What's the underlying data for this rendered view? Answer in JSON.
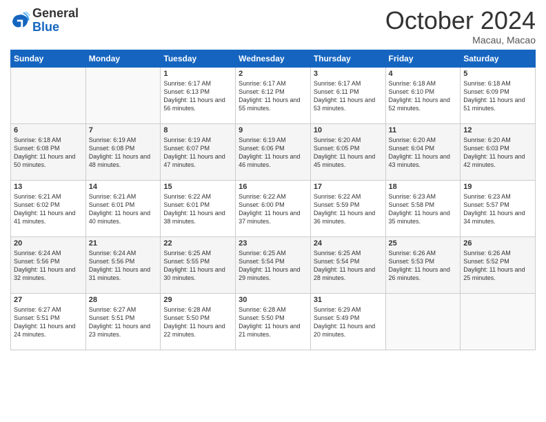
{
  "logo": {
    "line1": "General",
    "line2": "Blue"
  },
  "title": "October 2024",
  "location": "Macau, Macao",
  "days_of_week": [
    "Sunday",
    "Monday",
    "Tuesday",
    "Wednesday",
    "Thursday",
    "Friday",
    "Saturday"
  ],
  "weeks": [
    [
      {
        "day": "",
        "content": ""
      },
      {
        "day": "",
        "content": ""
      },
      {
        "day": "1",
        "content": "Sunrise: 6:17 AM\nSunset: 6:13 PM\nDaylight: 11 hours and 56 minutes."
      },
      {
        "day": "2",
        "content": "Sunrise: 6:17 AM\nSunset: 6:12 PM\nDaylight: 11 hours and 55 minutes."
      },
      {
        "day": "3",
        "content": "Sunrise: 6:17 AM\nSunset: 6:11 PM\nDaylight: 11 hours and 53 minutes."
      },
      {
        "day": "4",
        "content": "Sunrise: 6:18 AM\nSunset: 6:10 PM\nDaylight: 11 hours and 52 minutes."
      },
      {
        "day": "5",
        "content": "Sunrise: 6:18 AM\nSunset: 6:09 PM\nDaylight: 11 hours and 51 minutes."
      }
    ],
    [
      {
        "day": "6",
        "content": "Sunrise: 6:18 AM\nSunset: 6:08 PM\nDaylight: 11 hours and 50 minutes."
      },
      {
        "day": "7",
        "content": "Sunrise: 6:19 AM\nSunset: 6:08 PM\nDaylight: 11 hours and 48 minutes."
      },
      {
        "day": "8",
        "content": "Sunrise: 6:19 AM\nSunset: 6:07 PM\nDaylight: 11 hours and 47 minutes."
      },
      {
        "day": "9",
        "content": "Sunrise: 6:19 AM\nSunset: 6:06 PM\nDaylight: 11 hours and 46 minutes."
      },
      {
        "day": "10",
        "content": "Sunrise: 6:20 AM\nSunset: 6:05 PM\nDaylight: 11 hours and 45 minutes."
      },
      {
        "day": "11",
        "content": "Sunrise: 6:20 AM\nSunset: 6:04 PM\nDaylight: 11 hours and 43 minutes."
      },
      {
        "day": "12",
        "content": "Sunrise: 6:20 AM\nSunset: 6:03 PM\nDaylight: 11 hours and 42 minutes."
      }
    ],
    [
      {
        "day": "13",
        "content": "Sunrise: 6:21 AM\nSunset: 6:02 PM\nDaylight: 11 hours and 41 minutes."
      },
      {
        "day": "14",
        "content": "Sunrise: 6:21 AM\nSunset: 6:01 PM\nDaylight: 11 hours and 40 minutes."
      },
      {
        "day": "15",
        "content": "Sunrise: 6:22 AM\nSunset: 6:01 PM\nDaylight: 11 hours and 38 minutes."
      },
      {
        "day": "16",
        "content": "Sunrise: 6:22 AM\nSunset: 6:00 PM\nDaylight: 11 hours and 37 minutes."
      },
      {
        "day": "17",
        "content": "Sunrise: 6:22 AM\nSunset: 5:59 PM\nDaylight: 11 hours and 36 minutes."
      },
      {
        "day": "18",
        "content": "Sunrise: 6:23 AM\nSunset: 5:58 PM\nDaylight: 11 hours and 35 minutes."
      },
      {
        "day": "19",
        "content": "Sunrise: 6:23 AM\nSunset: 5:57 PM\nDaylight: 11 hours and 34 minutes."
      }
    ],
    [
      {
        "day": "20",
        "content": "Sunrise: 6:24 AM\nSunset: 5:56 PM\nDaylight: 11 hours and 32 minutes."
      },
      {
        "day": "21",
        "content": "Sunrise: 6:24 AM\nSunset: 5:56 PM\nDaylight: 11 hours and 31 minutes."
      },
      {
        "day": "22",
        "content": "Sunrise: 6:25 AM\nSunset: 5:55 PM\nDaylight: 11 hours and 30 minutes."
      },
      {
        "day": "23",
        "content": "Sunrise: 6:25 AM\nSunset: 5:54 PM\nDaylight: 11 hours and 29 minutes."
      },
      {
        "day": "24",
        "content": "Sunrise: 6:25 AM\nSunset: 5:54 PM\nDaylight: 11 hours and 28 minutes."
      },
      {
        "day": "25",
        "content": "Sunrise: 6:26 AM\nSunset: 5:53 PM\nDaylight: 11 hours and 26 minutes."
      },
      {
        "day": "26",
        "content": "Sunrise: 6:26 AM\nSunset: 5:52 PM\nDaylight: 11 hours and 25 minutes."
      }
    ],
    [
      {
        "day": "27",
        "content": "Sunrise: 6:27 AM\nSunset: 5:51 PM\nDaylight: 11 hours and 24 minutes."
      },
      {
        "day": "28",
        "content": "Sunrise: 6:27 AM\nSunset: 5:51 PM\nDaylight: 11 hours and 23 minutes."
      },
      {
        "day": "29",
        "content": "Sunrise: 6:28 AM\nSunset: 5:50 PM\nDaylight: 11 hours and 22 minutes."
      },
      {
        "day": "30",
        "content": "Sunrise: 6:28 AM\nSunset: 5:50 PM\nDaylight: 11 hours and 21 minutes."
      },
      {
        "day": "31",
        "content": "Sunrise: 6:29 AM\nSunset: 5:49 PM\nDaylight: 11 hours and 20 minutes."
      },
      {
        "day": "",
        "content": ""
      },
      {
        "day": "",
        "content": ""
      }
    ]
  ]
}
